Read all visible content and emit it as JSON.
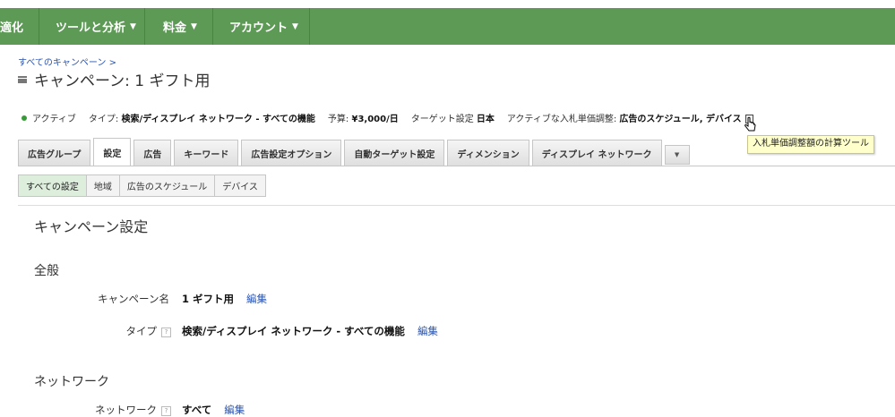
{
  "topnav": {
    "items": [
      {
        "label": "適化",
        "caret": ""
      },
      {
        "label": "ツールと分析",
        "caret": "▼"
      },
      {
        "label": "料金",
        "caret": "▼"
      },
      {
        "label": "アカウント",
        "caret": "▼"
      }
    ]
  },
  "breadcrumb": "すべてのキャンペーン >",
  "page_title": "キャンペーン: 1 ギフト用",
  "status": {
    "state": "アクティブ",
    "type_label": "タイプ:",
    "type_value": "検索/ディスプレイ ネットワーク - すべての機能",
    "budget_label": "予算:",
    "budget_value": "¥3,000/日",
    "target_label": "ターゲット設定",
    "target_value": "日本",
    "bid_label": "アクティブな入札単価調整:",
    "bid_value": "広告のスケジュール, デバイス"
  },
  "tooltip": "入札単価調整額の計算ツール",
  "tabs": [
    {
      "label": "広告グループ",
      "active": false
    },
    {
      "label": "設定",
      "active": true
    },
    {
      "label": "広告",
      "active": false
    },
    {
      "label": "キーワード",
      "active": false
    },
    {
      "label": "広告設定オプション",
      "active": false
    },
    {
      "label": "自動ターゲット設定",
      "active": false
    },
    {
      "label": "ディメンション",
      "active": false
    },
    {
      "label": "ディスプレイ ネットワーク",
      "active": false
    }
  ],
  "tab_more": "▼",
  "subtabs": [
    {
      "label": "すべての設定",
      "active": true
    },
    {
      "label": "地域",
      "active": false
    },
    {
      "label": "広告のスケジュール",
      "active": false
    },
    {
      "label": "デバイス",
      "active": false
    }
  ],
  "settings": {
    "title": "キャンペーン設定",
    "general_heading": "全般",
    "name_label": "キャンペーン名",
    "name_value": "1 ギフト用",
    "type_label": "タイプ",
    "type_value": "検索/ディスプレイ ネットワーク - すべての機能",
    "network_heading": "ネットワーク",
    "network_label": "ネットワーク",
    "network_value": "すべて",
    "edit_label": "編集",
    "help_glyph": "?"
  },
  "colors": {
    "topbar": "#5c9a55",
    "link": "#2a55b0",
    "active_dot": "#3a9a3a",
    "tooltip_bg": "#ffffcc"
  }
}
